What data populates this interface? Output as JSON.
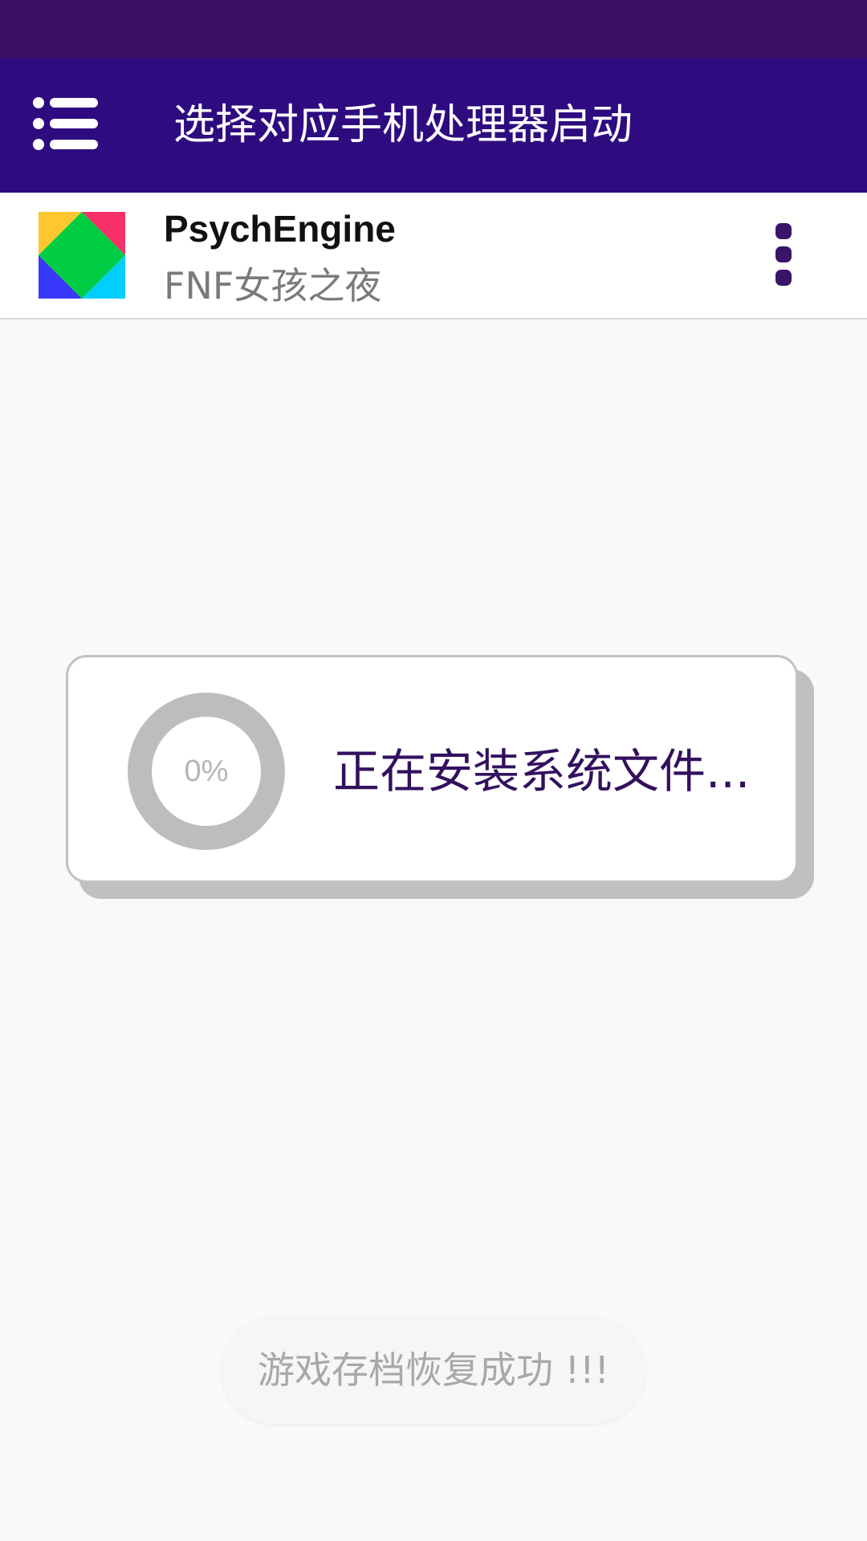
{
  "app_bar": {
    "title": "选择对应手机处理器启动",
    "menu_icon": "menu-list-icon",
    "background": "#2e0c80"
  },
  "status_bar": {
    "background": "#3a1063"
  },
  "app_row": {
    "name": "PsychEngine",
    "subtitle": "FNF女孩之夜",
    "logo_icon": "app-logo",
    "more_icon": "more-vertical-icon"
  },
  "dialog": {
    "progress_percent": 0,
    "progress_label": "0%",
    "message": "正在安装系统文件..."
  },
  "toast": {
    "message": "游戏存档恢复成功 !!!"
  },
  "colors": {
    "accent": "#33105e",
    "ring": "#bdbdbd",
    "page_background": "#f9f9f9"
  }
}
